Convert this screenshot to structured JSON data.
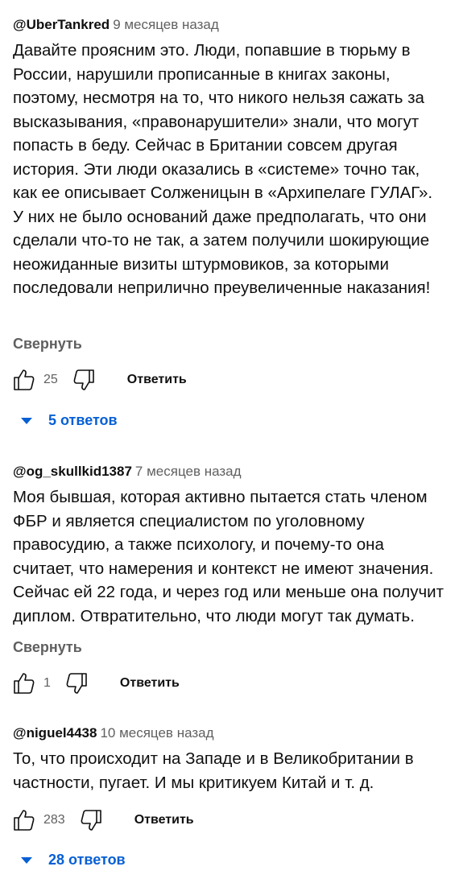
{
  "comments": [
    {
      "author": "@UberTankred",
      "time": "9 месяцев назад",
      "text": "Давайте проясним это. Люди, попавшие в тюрьму в\nРоссии, нарушили прописанные в книгах законы,\nпоэтому, несмотря на то, что никого нельзя сажать за\nвысказывания, «правонарушители» знали, что могут\nпопасть в беду. Сейчас в Британии совсем другая\nистория. Эти люди оказались в «системе» точно так,\nкак ее описывает Солженицын в «Архипелаге ГУЛАГ».\nУ них не было оснований даже предполагать, что они\nсделали что-то не так, а затем получили шокирующие\nнеожиданные визиты штурмовиков, за которыми\nпоследовали неприлично преувеличенные наказания!",
      "collapse_label": "Свернуть",
      "likes": "25",
      "reply_label": "Ответить",
      "replies_label": "5 ответов"
    },
    {
      "author": "@og_skullkid1387",
      "time": "7 месяцев назад",
      "text": "Моя бывшая, которая активно пытается стать членом\nФБР и является специалистом по уголовному\nправосудию, а также психологу, и почему-то она\nсчитает, что намерения и контекст не имеют значения.\nСейчас ей 22 года, и через год или меньше она получит\nдиплом. Отвратительно, что люди могут так думать.",
      "collapse_label": "Свернуть",
      "likes": "1",
      "reply_label": "Ответить"
    },
    {
      "author": "@niguel4438",
      "time": "10 месяцев назад",
      "text": "То, что происходит на Западе и в Великобритании в\nчастности, пугает. И мы критикуем Китай и т. д.",
      "likes": "283",
      "reply_label": "Ответить",
      "replies_label": "28 ответов"
    }
  ],
  "colors": {
    "text": "#0f0f0f",
    "secondary": "#606060",
    "link_blue": "#065fd4"
  },
  "icons": [
    "thumbs-up-icon",
    "thumbs-down-icon",
    "chevron-down-icon"
  ]
}
